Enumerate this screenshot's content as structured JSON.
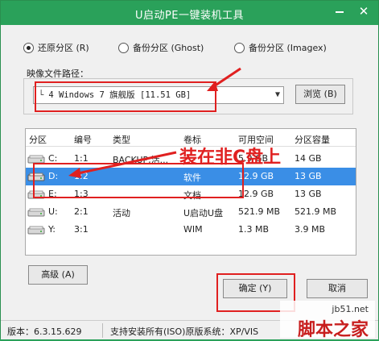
{
  "title": "U启动PE一键装机工具",
  "mode": {
    "options": [
      "还原分区 (R)",
      "备份分区 (Ghost)",
      "备份分区 (Imagex)"
    ],
    "selected_index": 0
  },
  "image_path": {
    "label": "映像文件路径：",
    "value": "4 Windows 7 旗舰版 [11.51 GB]",
    "browse_label": "浏览 (B)"
  },
  "table": {
    "headers": [
      "分区",
      "编号",
      "类型",
      "卷标",
      "可用空间",
      "分区容量"
    ],
    "rows": [
      {
        "partition": "C:",
        "number": "1:1",
        "type": "BACKUP,活...",
        "label": "",
        "free": "5.9 GB",
        "size": "14 GB",
        "selected": false
      },
      {
        "partition": "D:",
        "number": "1:2",
        "type": "",
        "label": "软件",
        "free": "12.9 GB",
        "size": "13 GB",
        "selected": true
      },
      {
        "partition": "E:",
        "number": "1:3",
        "type": "",
        "label": "文档",
        "free": "12.9 GB",
        "size": "13 GB",
        "selected": false
      },
      {
        "partition": "U:",
        "number": "2:1",
        "type": "活动",
        "label": "U启动U盘",
        "free": "521.9 MB",
        "size": "521.9 MB",
        "selected": false
      },
      {
        "partition": "Y:",
        "number": "3:1",
        "type": "",
        "label": "WIM",
        "free": "1.3 MB",
        "size": "3.9 MB",
        "selected": false
      }
    ]
  },
  "buttons": {
    "advanced": "高级 (A)",
    "ok": "确定 (Y)",
    "partial": "取消"
  },
  "status": {
    "version": "版本：6.3.15.629",
    "support": "支持安装所有(ISO)原版系统：XP/VIS"
  },
  "annotation": {
    "text": "装在非C盘上"
  },
  "watermark": {
    "site": "jb51.net",
    "name": "脚本之家"
  },
  "colors": {
    "titlebar": "#2aa15a",
    "selection": "#3a8ee6",
    "annotation": "#e02020"
  }
}
